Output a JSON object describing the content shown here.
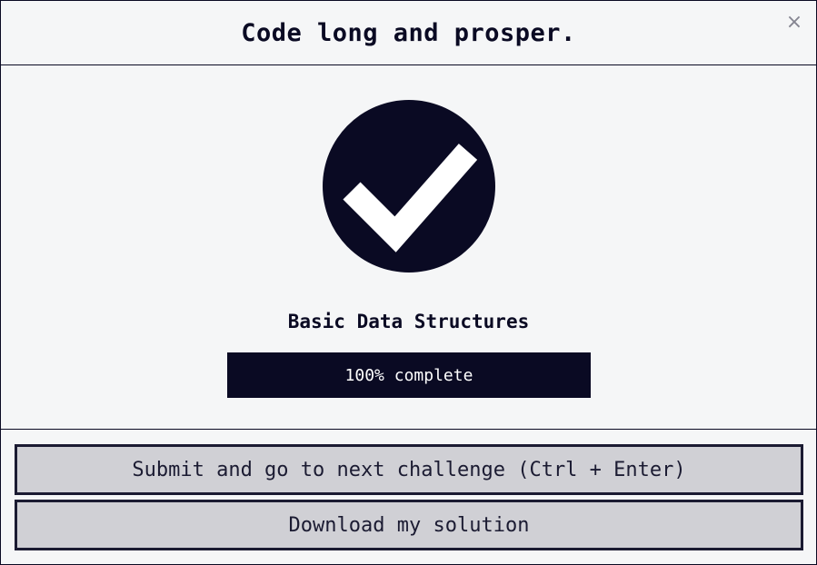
{
  "modal": {
    "title": "Code long and prosper.",
    "close_label": "×"
  },
  "challenge": {
    "title": "Basic Data Structures",
    "progress_percent": 100,
    "progress_text": "100% complete",
    "completed_icon": "check-circle-icon"
  },
  "actions": {
    "submit_label": "Submit and go to next challenge (Ctrl + Enter)",
    "download_label": "Download my solution"
  },
  "colors": {
    "primary": "#0a0a23",
    "background": "#f5f6f7",
    "button_bg": "#d0d0d5",
    "button_border": "#1b1b32",
    "close_icon": "#858591"
  }
}
